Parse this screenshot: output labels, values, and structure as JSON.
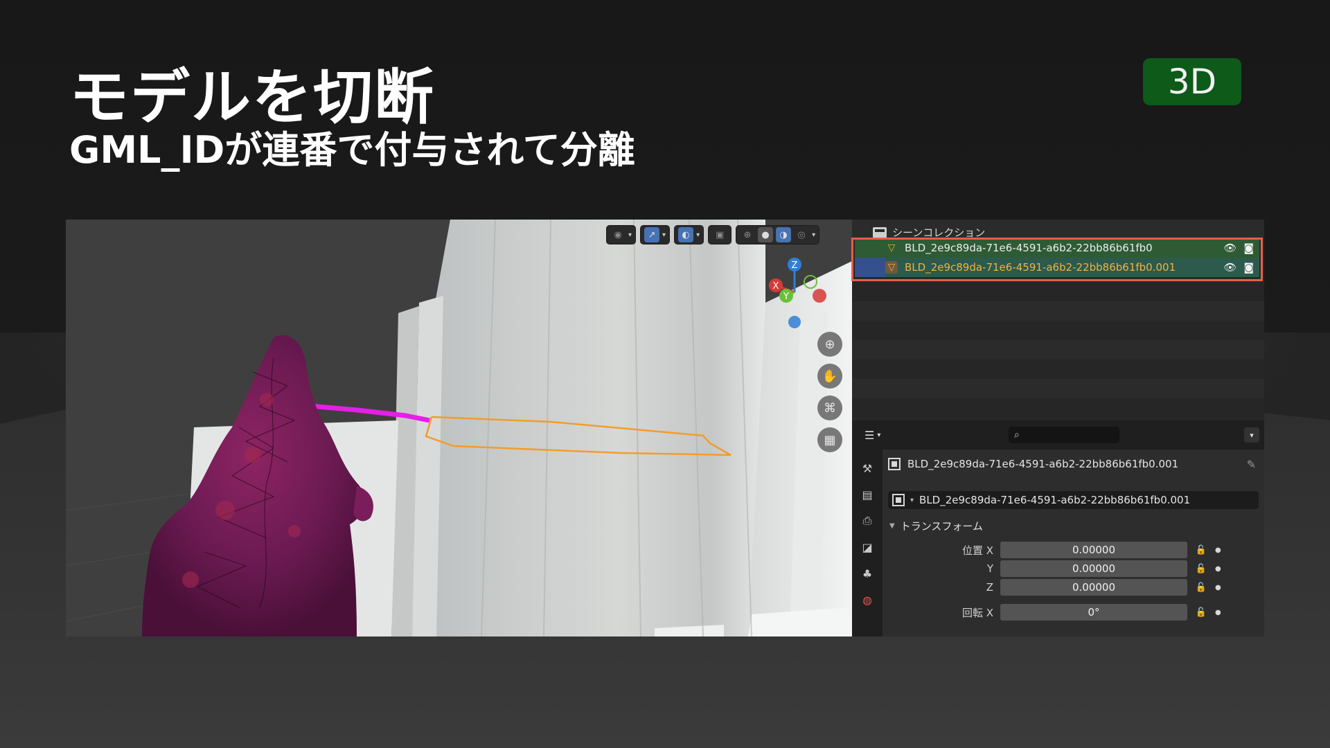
{
  "slide": {
    "title": "モデルを切断",
    "subtitle": "GML_IDが連番で付与されて分離",
    "tag": "3D"
  },
  "outliner": {
    "header": "シーンコレクション",
    "items": [
      {
        "name": "BLD_2e9c89da-71e6-4591-a6b2-22bb86b61fb0"
      },
      {
        "name": "BLD_2e9c89da-71e6-4591-a6b2-22bb86b61fb0.001"
      }
    ]
  },
  "properties": {
    "context_name": "BLD_2e9c89da-71e6-4591-a6b2-22bb86b61fb0.001",
    "object_name": "BLD_2e9c89da-71e6-4591-a6b2-22bb86b61fb0.001",
    "section": "トランスフォーム",
    "fields": [
      {
        "label": "位置 X",
        "value": "0.00000"
      },
      {
        "label": "Y",
        "value": "0.00000"
      },
      {
        "label": "Z",
        "value": "0.00000"
      },
      {
        "label": "回転 X",
        "value": "0°"
      }
    ]
  },
  "gizmo": {
    "z": "Z",
    "x": "X",
    "y": "Y"
  },
  "colors": {
    "tag_bg": "#0d5a19",
    "highlight": "#ea5d4b",
    "selected_row": "#2e5b34",
    "active_row": "#2c5a4c",
    "active_text": "#f0b341",
    "cut_outline": "#f39c2a",
    "magenta_line": "#e51fe5"
  }
}
